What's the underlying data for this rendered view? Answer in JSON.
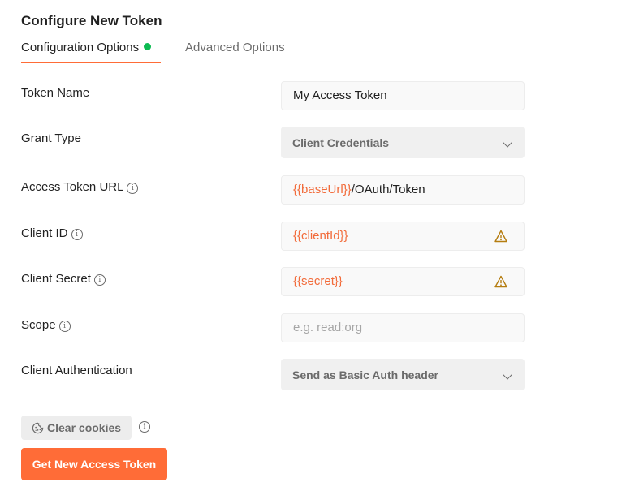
{
  "title": "Configure New Token",
  "tabs": [
    {
      "label": "Configuration Options",
      "active": true,
      "indicator": "green-dot"
    },
    {
      "label": "Advanced Options",
      "active": false
    }
  ],
  "fields": {
    "token_name": {
      "label": "Token Name",
      "value": "My Access Token"
    },
    "grant_type": {
      "label": "Grant Type",
      "value": "Client Credentials"
    },
    "access_token_url": {
      "label": "Access Token URL",
      "value_var": "{{baseUrl}}",
      "value_rest": "/OAuth/Token"
    },
    "client_id": {
      "label": "Client ID",
      "value": "{{clientId}}",
      "warning": true
    },
    "client_secret": {
      "label": "Client Secret",
      "value": "{{secret}}",
      "warning": true
    },
    "scope": {
      "label": "Scope",
      "value": "",
      "placeholder": "e.g. read:org"
    },
    "client_authentication": {
      "label": "Client Authentication",
      "value": "Send as Basic Auth header"
    }
  },
  "buttons": {
    "clear_cookies": "Clear cookies",
    "get_token": "Get New Access Token"
  },
  "colors": {
    "accent": "#ff6c37",
    "variable": "#f26b3a",
    "active_dot": "#0cbb52",
    "warning": "#b57d10"
  }
}
